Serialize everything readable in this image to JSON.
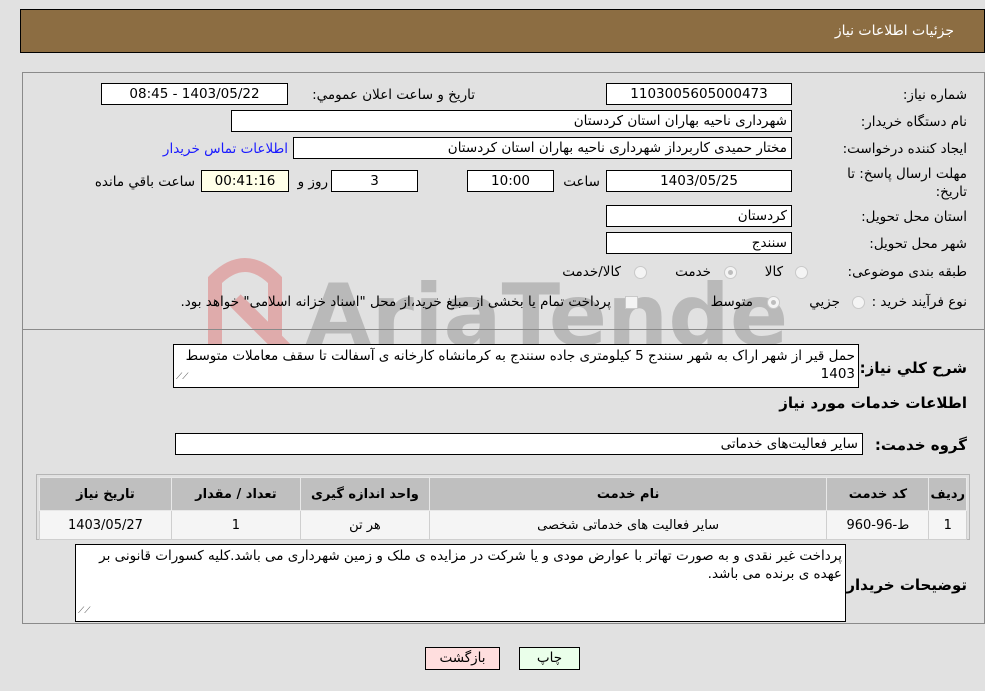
{
  "header": {
    "title": "جزئیات اطلاعات نیاز"
  },
  "fields": {
    "need_number": {
      "label": "شماره نیاز:",
      "value": "1103005605000473"
    },
    "announce_datetime": {
      "label": "تاریخ و ساعت اعلان عمومي:",
      "value": "1403/05/22 - 08:45"
    },
    "buyer_org": {
      "label": "نام دستگاه خریدار:",
      "value": "شهرداری ناحیه بهاران استان کردستان"
    },
    "requester": {
      "label": "ایجاد کننده درخواست:",
      "value": "مختار حمیدی کاربرداز شهرداری ناحیه بهاران استان کردستان"
    },
    "buyer_contact_link": "اطلاعات تماس خریدار",
    "deadline": {
      "label_line1": "مهلت ارسال پاسخ: تا",
      "label_line2": "تاریخ:",
      "date": "1403/05/25",
      "time_label": "ساعت",
      "time": "10:00",
      "days": "3",
      "days_label": "روز و",
      "remaining": "00:41:16",
      "remaining_label": "ساعت باقي مانده"
    },
    "delivery_province": {
      "label": "استان محل تحویل:",
      "value": "کردستان"
    },
    "delivery_city": {
      "label": "شهر محل تحویل:",
      "value": "سنندج"
    },
    "subject_category": {
      "label": "طبقه بندی موضوعی:",
      "options": [
        "کالا",
        "خدمت",
        "کالا/خدمت"
      ],
      "selected": "خدمت"
    },
    "purchase_process": {
      "label": "نوع فرآیند خرید :",
      "options": [
        "جزیي",
        "متوسط"
      ],
      "selected": "متوسط",
      "treasury_note": "پرداخت تمام یا بخشی از مبلغ خرید،از محل \"اسناد خزانه اسلامی\" خواهد بود."
    }
  },
  "description": {
    "label": "شرح کلي نیاز:",
    "value": "حمل قیر از شهر اراک به شهر سنندج 5 کیلومتری جاده سنندج به کرمانشاه کارخانه ی آسفالت تا سقف معاملات متوسط 1403"
  },
  "services_section": {
    "title": "اطلاعات خدمات مورد نیاز",
    "service_group": {
      "label": "گروه خدمت:",
      "value": "سایر فعالیت‌های خدماتی"
    },
    "table": {
      "headers": [
        "ردیف",
        "کد خدمت",
        "نام خدمت",
        "واحد اندازه گیری",
        "تعداد / مقدار",
        "تاریخ نیاز"
      ],
      "rows": [
        [
          "1",
          "ط-96-960",
          "سایر فعالیت های خدماتی شخصی",
          "هر تن",
          "1",
          "1403/05/27"
        ]
      ]
    }
  },
  "buyer_notes": {
    "label": "توضیحات خریدار:",
    "value": "پرداخت  غیر نقدی و به صورت تهاتر با عوارض مودی و یا شرکت در مزایده ی ملک و زمین شهرداری می باشد.کلیه کسورات قانونی بر عهده ی برنده می باشد."
  },
  "buttons": {
    "print": "چاپ",
    "back": "بازگشت"
  },
  "watermark": {
    "text": "AriaTender.neT"
  },
  "colors": {
    "header_bg": "#8c6d42",
    "print_bg": "#eaffea",
    "back_bg": "#ffdede",
    "link": "#1a1aff"
  }
}
